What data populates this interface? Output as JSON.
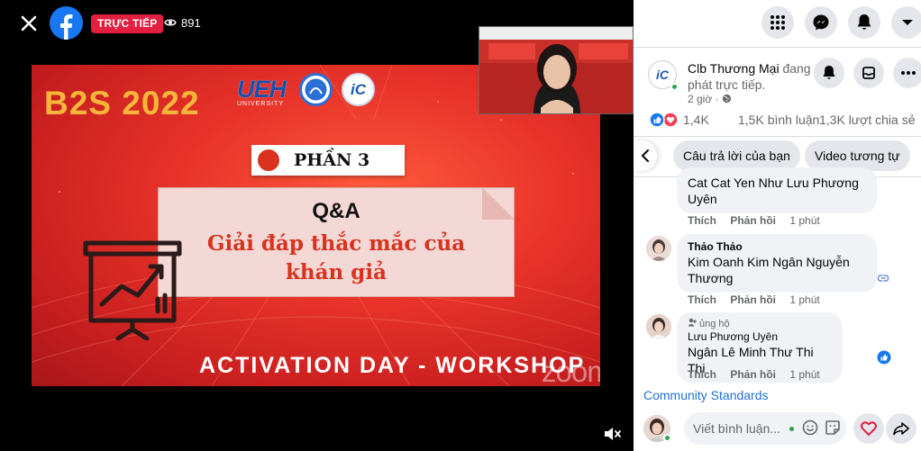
{
  "video": {
    "live_label": "TRỰC TIẾP",
    "viewer_count": "891",
    "slide": {
      "title": "B2S 2022",
      "logo_text": "UEH",
      "logo_subtext": "UNIVERSITY",
      "logo_badge": "iC",
      "part": "PHẦN 3",
      "qa": "Q&A",
      "answer_line1": "Giải đáp thắc mắc của",
      "answer_line2": "khán giả",
      "banner": "ACTIVATION DAY - WORKSHOP",
      "watermark": "zoom"
    }
  },
  "panel": {
    "page": {
      "name": "Clb Thương Mại",
      "status": "đang phát trực tiếp.",
      "time": "2 giờ ·",
      "avatar_text": "iC"
    },
    "stats": {
      "likes": "1,4K",
      "comments": "1,5K bình luận",
      "shares": "1,3K lượt chia sẻ"
    },
    "chips": [
      "Câu trả lời của bạn",
      "Video tương tự"
    ],
    "comments": [
      {
        "author": "",
        "text_line1": "Cat Cat Yen Như Lưu Phương",
        "text_line2": "Uyên",
        "like": "Thích",
        "reply": "Phản hồi",
        "time": "1 phút"
      },
      {
        "author": "Thảo Thảo",
        "text_line1": "Kim Oanh Kim Ngân Nguyễn",
        "text_line2": "Thương",
        "like": "Thích",
        "reply": "Phản hồi",
        "time": "1 phút"
      },
      {
        "role": "ủng hộ",
        "author": "Lưu Phương Uyên",
        "text_line1": "Ngân Lê Minh Thư Thi Thi",
        "like": "Thích",
        "reply": "Phản hồi",
        "time": "1 phút"
      }
    ],
    "community_standards": "Community Standards",
    "composer": {
      "placeholder": "Viết bình luận..."
    }
  },
  "colors": {
    "facebook_blue": "#1877f2",
    "live_red": "#e41e3f",
    "slide_gold": "#f6b63a",
    "slide_red": "#d9321e",
    "link_blue": "#216fdb"
  },
  "icons": [
    "close-icon",
    "facebook-logo-icon",
    "eye-icon",
    "volume-icon",
    "menu-grid-icon",
    "messenger-icon",
    "bell-icon",
    "chevron-down-icon",
    "archive-icon",
    "more-icon",
    "globe-icon",
    "like-reaction-icon",
    "love-reaction-icon",
    "chevron-left-icon",
    "link-icon",
    "like-badge-icon",
    "emoji-icon",
    "sticker-icon",
    "heart-icon",
    "share-icon"
  ]
}
